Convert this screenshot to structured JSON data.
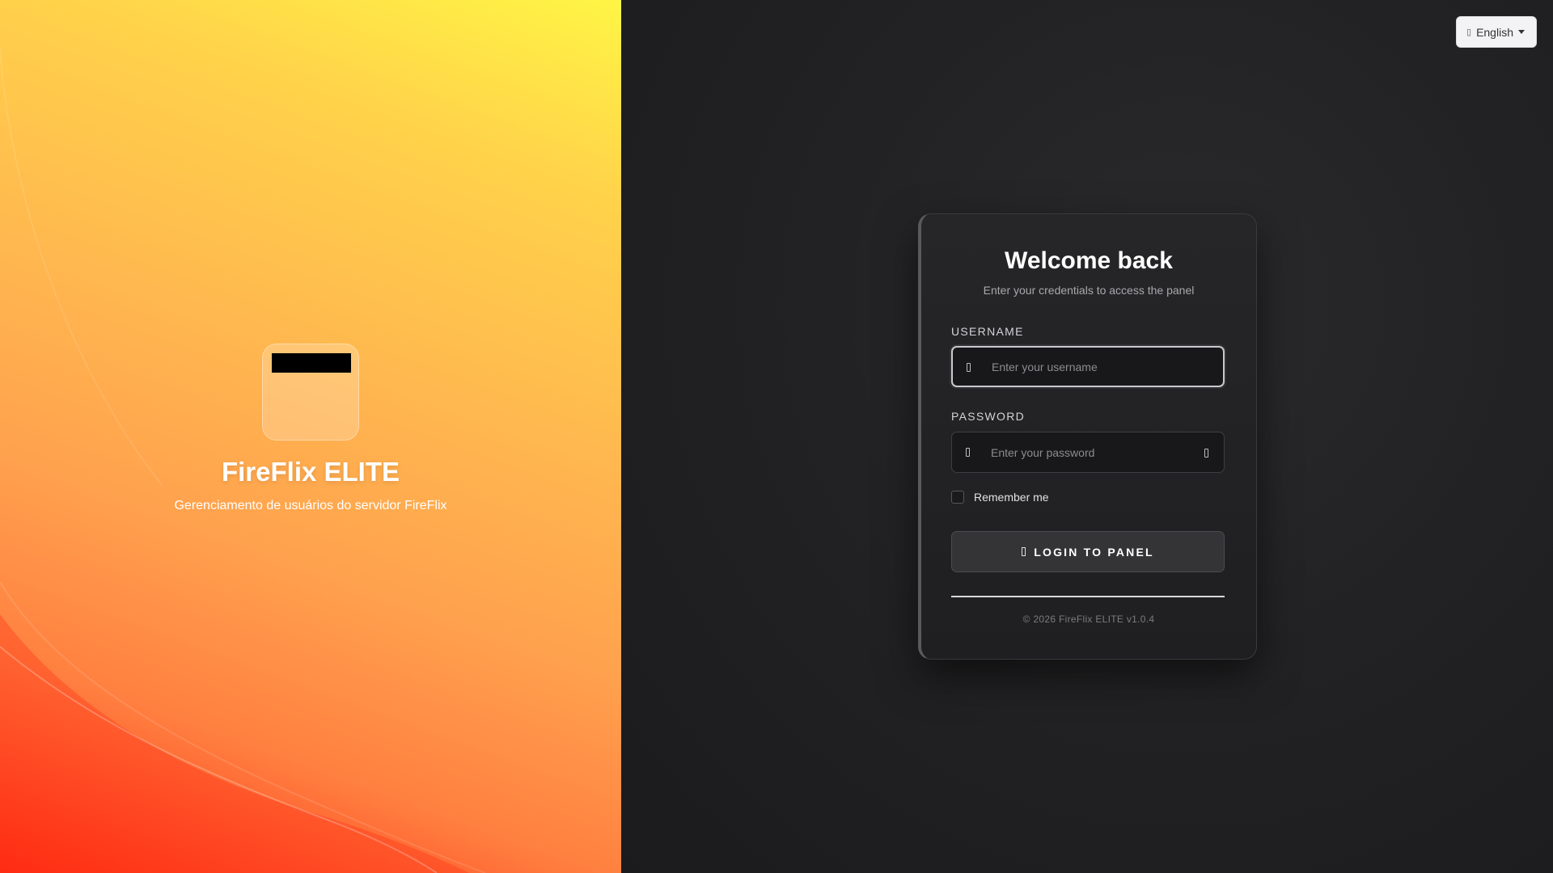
{
  "brand": {
    "title": "FireFlix ELITE",
    "subtitle": "Gerenciamento de usuários do servidor FireFlix"
  },
  "language": {
    "selected": "English",
    "icon": "globe-icon"
  },
  "login": {
    "title": "Welcome back",
    "subtitle": "Enter your credentials to access the panel",
    "username_label": "USERNAME",
    "username_placeholder": "Enter your username",
    "username_value": "",
    "password_label": "PASSWORD",
    "password_placeholder": "Enter your password",
    "password_value": "",
    "remember_label": "Remember me",
    "remember_checked": false,
    "submit_label": "LOGIN TO PANEL"
  },
  "footer": {
    "text": "© 2026 FireFlix ELITE v1.0.4"
  },
  "colors": {
    "gradient_top": "#fff545",
    "gradient_bottom": "#ff2a12",
    "panel_bg": "#1f1f21"
  }
}
